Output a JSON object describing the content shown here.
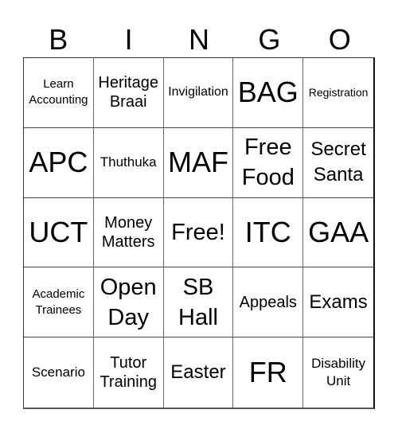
{
  "header": {
    "letters": [
      "B",
      "I",
      "N",
      "G",
      "O"
    ]
  },
  "cells": [
    {
      "label": "Learn Accounting"
    },
    {
      "label": "Heritage Braai"
    },
    {
      "label": "Invigilation"
    },
    {
      "label": "BAG"
    },
    {
      "label": "Registration"
    },
    {
      "label": "APC"
    },
    {
      "label": "Thuthuka"
    },
    {
      "label": "MAF"
    },
    {
      "label": "Free Food"
    },
    {
      "label": "Secret Santa"
    },
    {
      "label": "UCT"
    },
    {
      "label": "Money Matters"
    },
    {
      "label": "Free!"
    },
    {
      "label": "ITC"
    },
    {
      "label": "GAA"
    },
    {
      "label": "Academic Trainees"
    },
    {
      "label": "Open Day"
    },
    {
      "label": "SB Hall"
    },
    {
      "label": "Appeals"
    },
    {
      "label": "Exams"
    },
    {
      "label": "Scenario"
    },
    {
      "label": "Tutor Training"
    },
    {
      "label": "Easter"
    },
    {
      "label": "FR"
    },
    {
      "label": "Disability Unit"
    }
  ],
  "colors": {
    "background": "#ffffff",
    "text": "#000000",
    "grid_line": "#444444"
  }
}
